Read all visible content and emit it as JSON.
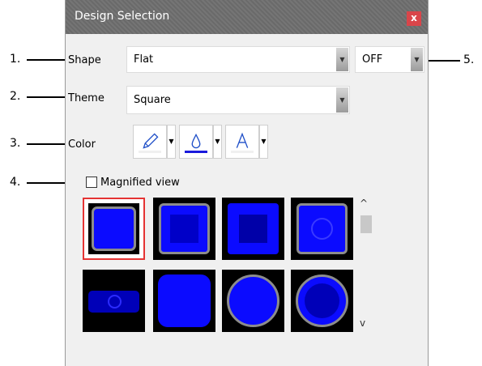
{
  "callouts": {
    "c1": "1.",
    "c2": "2.",
    "c3": "3.",
    "c4": "4.",
    "c5": "5."
  },
  "dialog": {
    "title": "Design Selection",
    "close_label": "x"
  },
  "shape": {
    "label": "Shape",
    "value": "Flat",
    "state_value": "OFF"
  },
  "theme": {
    "label": "Theme",
    "value": "Square"
  },
  "color": {
    "label": "Color",
    "buttons": [
      {
        "icon": "pencil-icon",
        "bar_color": "#ffffff"
      },
      {
        "icon": "fill-drop-icon",
        "bar_color": "#1a1adc"
      },
      {
        "icon": "text-color-icon",
        "bar_color": "#ffffff"
      }
    ]
  },
  "magnified": {
    "label": "Magnified view",
    "checked": false
  },
  "icons": {
    "dropdown": "▼",
    "scroll_up": "^",
    "scroll_down": "v"
  },
  "gallery": {
    "selected_index": 0,
    "items": [
      "square-frame",
      "square-inset-dark",
      "square-inset-darker",
      "square-circle",
      "oblong-pill-dot",
      "rounded-square",
      "circle-ring",
      "circle-ring-inset"
    ]
  },
  "colors": {
    "blue": "#0b0bff",
    "dark_blue": "#0000b8",
    "selection": "#e53333",
    "frame_gray": "#8c8c8c"
  }
}
